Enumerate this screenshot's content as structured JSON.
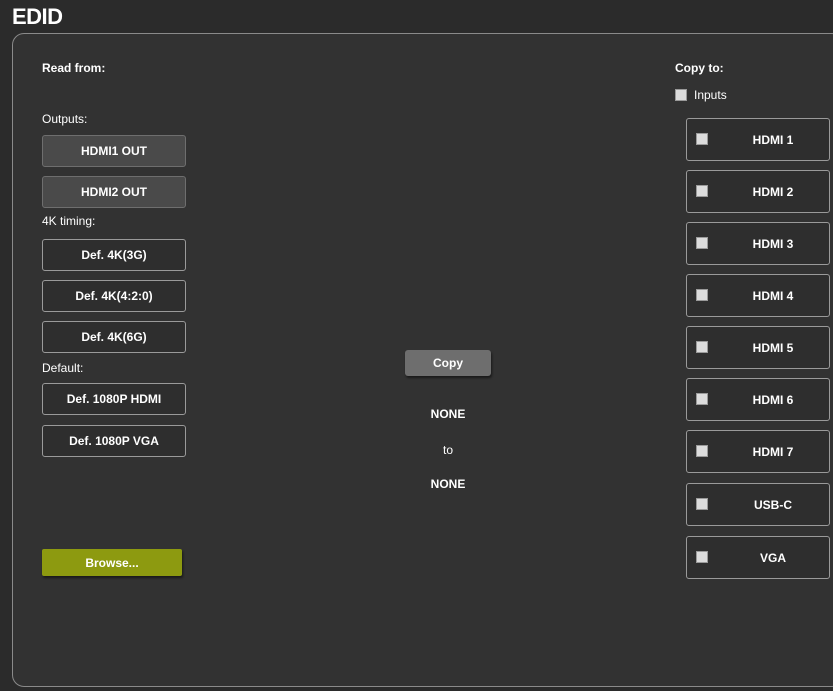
{
  "title": "EDID",
  "read_from": {
    "label": "Read from:",
    "outputs_label": "Outputs:",
    "outputs": [
      "HDMI1 OUT",
      "HDMI2 OUT"
    ],
    "timing_label": "4K timing:",
    "timing": [
      "Def. 4K(3G)",
      "Def. 4K(4:2:0)",
      "Def. 4K(6G)"
    ],
    "default_label": "Default:",
    "defaults": [
      "Def. 1080P HDMI",
      "Def. 1080P VGA"
    ],
    "browse_label": "Browse..."
  },
  "center": {
    "copy_label": "Copy",
    "source": "NONE",
    "to": "to",
    "destination": "NONE"
  },
  "copy_to": {
    "label": "Copy to:",
    "inputs_label": "Inputs",
    "targets": [
      "HDMI 1",
      "HDMI 2",
      "HDMI 3",
      "HDMI 4",
      "HDMI 5",
      "HDMI 6",
      "HDMI 7",
      "USB-C",
      "VGA"
    ]
  },
  "colors": {
    "background": "#2b2b2b",
    "panel": "#323232",
    "browse": "#8d9a10",
    "copy": "#6e6e6e"
  }
}
